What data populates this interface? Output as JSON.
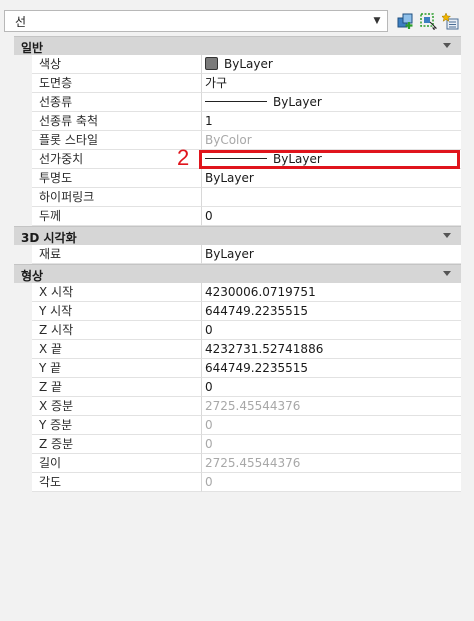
{
  "selector": {
    "value": "선"
  },
  "sections": [
    {
      "title": "일반",
      "rows": [
        {
          "name": "색상",
          "value": "ByLayer",
          "kind": "swatch"
        },
        {
          "name": "도면층",
          "value": "가구"
        },
        {
          "name": "선종류",
          "value": "ByLayer",
          "kind": "line"
        },
        {
          "name": "선종류 축척",
          "value": "1"
        },
        {
          "name": "플롯 스타일",
          "value": "ByColor",
          "dim": true
        },
        {
          "name": "선가중치",
          "value": "ByLayer",
          "kind": "line"
        },
        {
          "name": "투명도",
          "value": "ByLayer"
        },
        {
          "name": "하이퍼링크",
          "value": ""
        },
        {
          "name": "두께",
          "value": "0"
        }
      ]
    },
    {
      "title": "3D 시각화",
      "rows": [
        {
          "name": "재료",
          "value": "ByLayer"
        }
      ]
    },
    {
      "title": "형상",
      "rows": [
        {
          "name": "X 시작",
          "value": "4230006.0719751"
        },
        {
          "name": "Y 시작",
          "value": "644749.2235515"
        },
        {
          "name": "Z 시작",
          "value": "0"
        },
        {
          "name": "X 끝",
          "value": "4232731.52741886"
        },
        {
          "name": "Y 끝",
          "value": "644749.2235515"
        },
        {
          "name": "Z 끝",
          "value": "0"
        },
        {
          "name": "X 증분",
          "value": "2725.45544376",
          "dim": true
        },
        {
          "name": "Y 증분",
          "value": "0",
          "dim": true
        },
        {
          "name": "Z 증분",
          "value": "0",
          "dim": true
        },
        {
          "name": "길이",
          "value": "2725.45544376",
          "dim": true
        },
        {
          "name": "각도",
          "value": "0",
          "dim": true
        }
      ]
    }
  ],
  "annotation": {
    "label": "2",
    "color": "#e0141c"
  },
  "colors": {
    "header": "#d6d6d6",
    "swatch": "#7a7a7a"
  }
}
